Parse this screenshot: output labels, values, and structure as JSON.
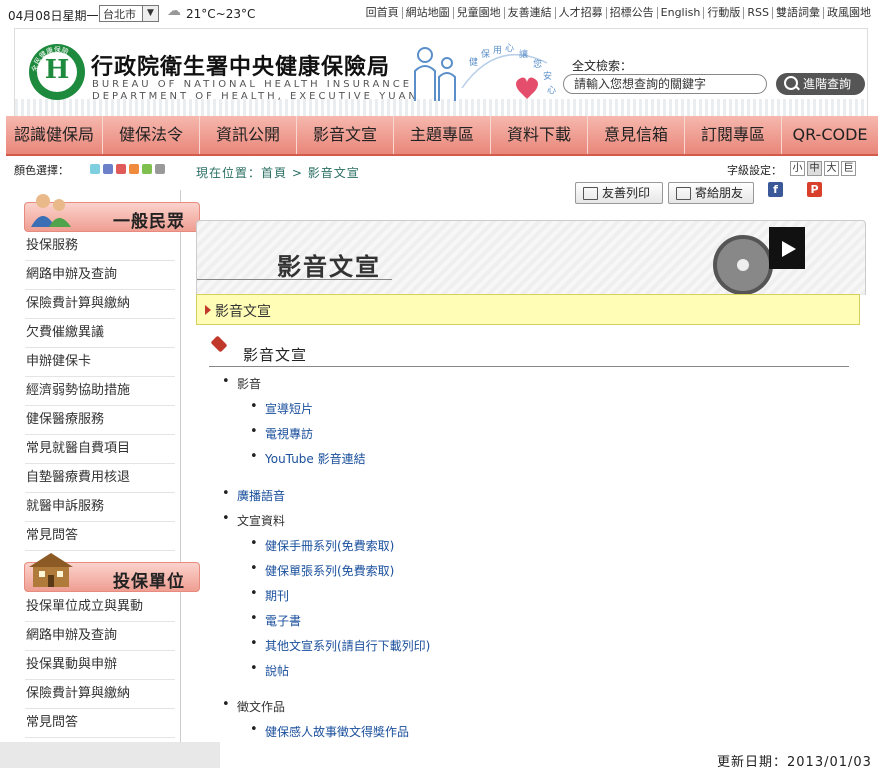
{
  "topbar": {
    "date": "04月08日星期一",
    "city": "台北市",
    "temp": "21°C~23°C",
    "links": [
      "回首頁",
      "網站地圖",
      "兒童園地",
      "友善連結",
      "人才招募",
      "招標公告",
      "English",
      "行動版",
      "RSS",
      "雙語詞彙",
      "政風園地"
    ]
  },
  "header": {
    "org_name": "行政院衛生署中央健康保險局",
    "org_en1": "BUREAU OF NATIONAL HEALTH INSURANCE",
    "org_en2": "DEPARTMENT OF HEALTH, EXECUTIVE YUAN",
    "logo_text": "全民健康保險",
    "deco_words": [
      "健",
      "保",
      "用",
      "心",
      "讓",
      "您",
      "安",
      "心"
    ],
    "search_label": "全文檢索：",
    "search_placeholder": "請輸入您想查詢的關鍵字",
    "search_button": "進階查詢"
  },
  "nav": [
    "認識健保局",
    "健保法令",
    "資訊公開",
    "影音文宣",
    "主題專區",
    "資料下載",
    "意見信箱",
    "訂閱專區",
    "QR-CODE"
  ],
  "color_label": "顏色選擇：",
  "swatch_colors": [
    "#7ecfe0",
    "#6c7fc9",
    "#e05a5a",
    "#f08a3c",
    "#7fbf4d",
    "#999999"
  ],
  "breadcrumb": {
    "prefix": "現在位置：",
    "home": "首頁",
    "sep": " > ",
    "current": "影音文宣"
  },
  "font_size": {
    "label": "字級設定：",
    "options": [
      "小",
      "中",
      "大",
      "巨"
    ]
  },
  "tools": {
    "print": "友善列印",
    "send": "寄給朋友",
    "facebook": "f",
    "plurk": "P"
  },
  "sidebar": {
    "group1": {
      "title": "一般民眾",
      "items": [
        "投保服務",
        "網路申辦及查詢",
        "保險費計算與繳納",
        "欠費催繳異議",
        "申辦健保卡",
        "經濟弱勢協助措施",
        "健保醫療服務",
        "常見就醫自費項目",
        "自墊醫療費用核退",
        "就醫申訴服務",
        "常見問答"
      ]
    },
    "group2": {
      "title": "投保單位",
      "items": [
        "投保單位成立與異動",
        "網路申辦及查詢",
        "投保異動與申辦",
        "保險費計算與繳納",
        "常見問答"
      ]
    }
  },
  "content": {
    "banner_title": "影音文宣",
    "sub_title": "影音文宣",
    "section_title": "影音文宣",
    "tree": {
      "a": {
        "label": "影音",
        "items": [
          "宣導短片",
          "電視專訪",
          "YouTube 影音連結"
        ]
      },
      "b": {
        "label": "廣播語音"
      },
      "c": {
        "label": "文宣資料",
        "items": [
          "健保手冊系列(免費索取)",
          "健保單張系列(免費索取)",
          "期刊",
          "電子書",
          "其他文宣系列(請自行下載列印)",
          "說帖"
        ]
      },
      "d": {
        "label": "徵文作品",
        "items": [
          "健保感人故事徵文得獎作品"
        ]
      }
    },
    "update": "更新日期：2013/01/03"
  }
}
